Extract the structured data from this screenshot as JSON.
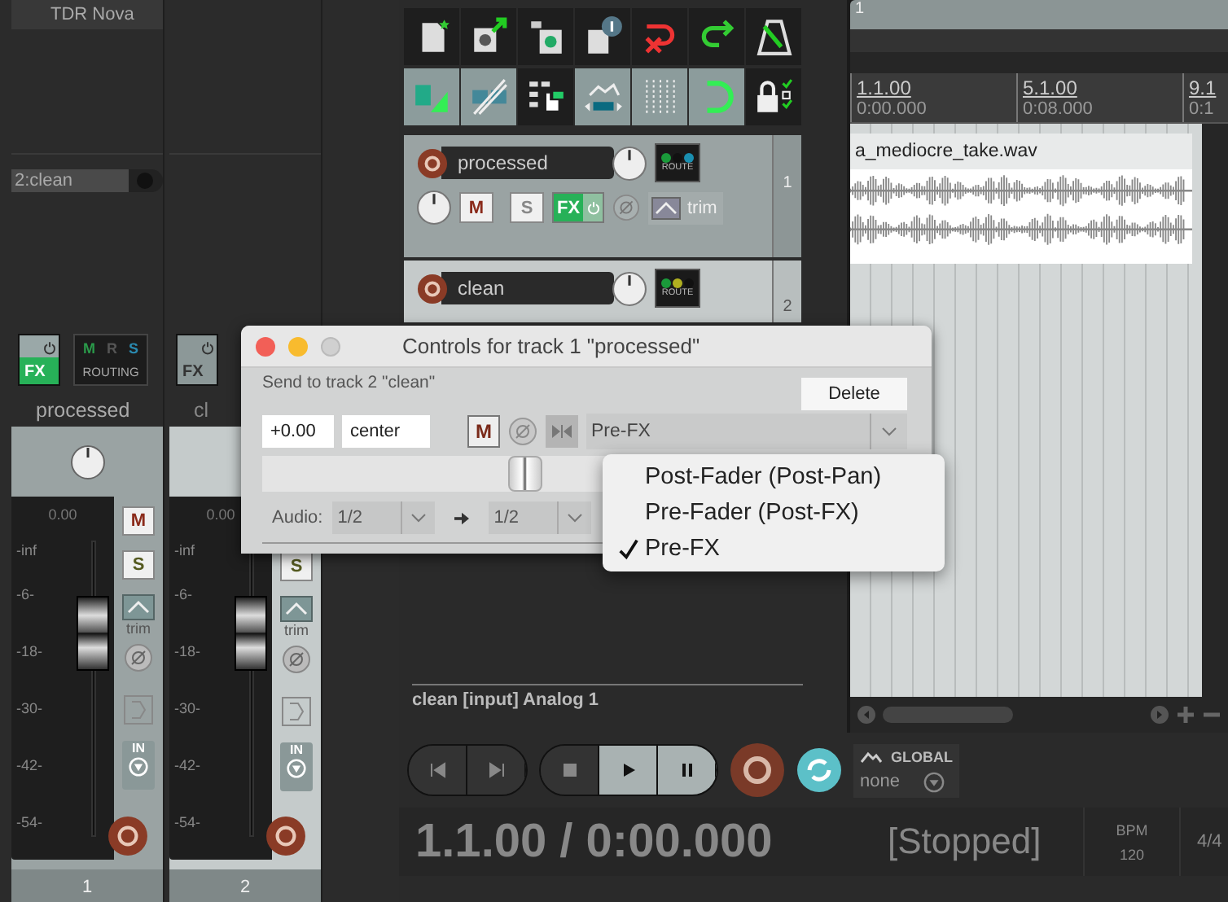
{
  "mixer": {
    "strips": [
      {
        "fx_slots": [
          "TDR Nova"
        ],
        "sends": [
          "2:clean"
        ],
        "fx": {
          "label": "FX",
          "on": true
        },
        "routing": {
          "label": "ROUTING",
          "letters": [
            "M",
            "R",
            "S"
          ]
        },
        "name": "processed",
        "selected": true,
        "volume": "0.00",
        "scale": [
          "-inf",
          "-6-",
          "-18-",
          "-30-",
          "-42-",
          "-54-"
        ],
        "level": 0.69,
        "mute": "M",
        "solo": "S",
        "env_label": "trim",
        "input_label": "IN",
        "number": "1"
      },
      {
        "fx": {
          "label": "FX",
          "on": false
        },
        "name": "cl",
        "selected": false,
        "volume": "0.00",
        "scale": [
          "-inf",
          "-6-",
          "-18-",
          "-30-",
          "-42-",
          "-54-"
        ],
        "level": 0.69,
        "solo": "S",
        "env_label": "trim",
        "input_label": "IN",
        "number": "2"
      }
    ]
  },
  "toolbar": {
    "rows": [
      [
        {
          "on": false
        },
        {
          "on": false
        },
        {
          "on": false
        },
        {
          "on": false
        },
        {
          "on": false
        },
        {
          "on": false
        },
        {
          "on": false
        }
      ],
      [
        {
          "on": true
        },
        {
          "on": true
        },
        {
          "on": false
        },
        {
          "on": true
        },
        {
          "on": true
        },
        {
          "on": true
        },
        {
          "on": false
        }
      ]
    ]
  },
  "tracks": [
    {
      "name": "processed",
      "selected": true,
      "route_label": "ROUTE",
      "route_dots": [
        {
          "color": "#1a9a3a"
        },
        {
          "color": "#111111"
        },
        {
          "color": "#1a8fb0"
        }
      ],
      "mute": "M",
      "solo": "S",
      "fx": {
        "label": "FX",
        "on": true
      },
      "env_label": "trim",
      "number": "1"
    },
    {
      "name": "clean",
      "selected": false,
      "route_label": "ROUTE",
      "route_dots": [
        {
          "color": "#1a9a3a"
        },
        {
          "color": "#b0b020"
        },
        {
          "color": "#111111"
        }
      ],
      "number": "2"
    }
  ],
  "input_status": "clean [input] Analog 1",
  "arrange": {
    "region": "1",
    "ruler": [
      {
        "bar": "1.1.00",
        "time": "0:00.000"
      },
      {
        "bar": "5.1.00",
        "time": "0:08.000"
      },
      {
        "bar": "9.1",
        "time": "0:1"
      }
    ],
    "item": "a_mediocre_take.wav"
  },
  "dialog": {
    "title": "Controls for track 1 \"processed\"",
    "subtitle": "Send to track 2 \"clean\"",
    "delete": "Delete",
    "volume": "+0.00",
    "pan": "center",
    "mute": "M",
    "mode": "Pre-FX",
    "level": 0.41,
    "audio_label": "Audio:",
    "source": "1/2",
    "dest": "1/2",
    "menu": [
      {
        "label": "Post-Fader (Post-Pan)",
        "checked": false
      },
      {
        "label": "Pre-Fader (Post-FX)",
        "checked": false
      },
      {
        "label": "Pre-FX",
        "checked": true
      }
    ]
  },
  "transport": {
    "repeat_on": true,
    "automation_label": "GLOBAL",
    "automation_mode": "none",
    "position": "1.1.00 / 0:00.000",
    "state": "[Stopped]",
    "bpm_label": "BPM",
    "bpm": "120",
    "time_signature": "4/4"
  }
}
